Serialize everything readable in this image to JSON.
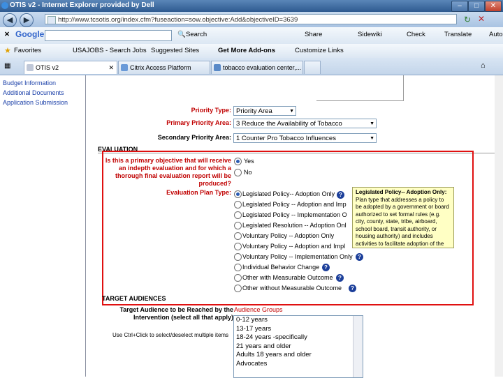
{
  "window": {
    "title": "OTIS v2 - Internet Explorer provided by Dell"
  },
  "address": {
    "url": "http://www.tcsotis.org/index.cfm?fuseaction=sow.objective:Add&objectiveID=3639"
  },
  "google_toolbar": {
    "logo": "Google",
    "search_label": "Search",
    "share_label": "Share",
    "sidewiki_label": "Sidewiki",
    "check_label": "Check",
    "translate_label": "Translate",
    "autofill_label": "Auto"
  },
  "favorites_bar": {
    "favorites_label": "Favorites",
    "links": [
      "USAJOBS - Search Jobs",
      "Suggested Sites",
      "Get More Add-ons",
      "Customize Links"
    ]
  },
  "tabs": [
    {
      "label": "OTIS v2"
    },
    {
      "label": "Citrix Access Platform"
    },
    {
      "label": "tobacco evaluation center,..."
    }
  ],
  "sidebar": {
    "links": [
      "Budget Information",
      "Additional Documents",
      "Application Submission"
    ]
  },
  "form": {
    "priority_type": {
      "label": "Priority Type:",
      "value": "Priority Area"
    },
    "primary_priority": {
      "label": "Primary Priority Area:",
      "value": "3 Reduce the Availability of Tobacco"
    },
    "secondary_priority": {
      "label": "Secondary Priority Area:",
      "value": "1 Counter Pro Tobacco Influences"
    },
    "evaluation": {
      "header": "EVALUATION",
      "question_lines": [
        "Is this a primary objective that will receive",
        "an indepth evaluation and for which a",
        "thorough final evaluation report will be",
        "produced?"
      ],
      "yes_label": "Yes",
      "no_label": "No",
      "plan_type_label": "Evaluation Plan Type:",
      "plan_options": [
        "Legislated Policy-- Adoption Only",
        "Legislated Policy -- Adoption and Imp",
        "Legislated Policy -- Implementation O",
        "Legislated Resolution -- Adoption Onl",
        "Voluntary Policy -- Adoption Only",
        "Voluntary Policy -- Adoption and Impl",
        "Voluntary Policy -- Implementation Only",
        "Individual Behavior Change",
        "Other with Measurable Outcome",
        "Other without Measurable Outcome"
      ],
      "tooltip_title": "Legislated Policy-- Adoption Only:",
      "tooltip_text": "Plan type that addresses a policy to be adopted by a government or board authorized to set formal rules (e.g. city, county, state, tribe, airboard, school board, transit authority, or housing authority) and includes activities to facilitate adoption of the policy"
    },
    "target": {
      "header": "TARGET AUDIENCES",
      "label_line1": "Target Audience to be Reached by the",
      "label_line2": "Intervention (select all that apply)",
      "groups_label": "Audience Groups",
      "hint": "Use Ctrl+Click to select/deselect multiple items",
      "options": [
        "0-12 years",
        "13-17 years",
        "18-24 years -specifically",
        "21 years and older",
        "Adults 18 years and older",
        "Advocates"
      ]
    }
  },
  "colors": {
    "label_red": "#c00000",
    "highlight_box": "#e01010",
    "tooltip_bg": "#ffffc4",
    "link": "#1a3fa8"
  }
}
